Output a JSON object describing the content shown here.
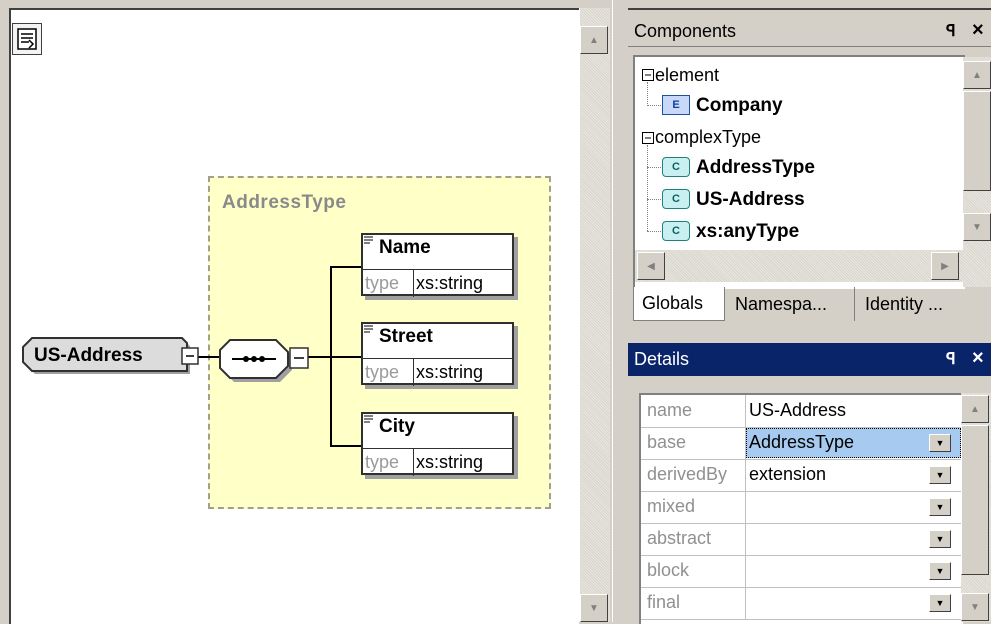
{
  "diagram": {
    "root_element": "US-Address",
    "complex_type_label": "AddressType",
    "compositor": "sequence",
    "children": [
      {
        "name": "Name",
        "type_label": "type",
        "type_value": "xs:string"
      },
      {
        "name": "Street",
        "type_label": "type",
        "type_value": "xs:string"
      },
      {
        "name": "City",
        "type_label": "type",
        "type_value": "xs:string"
      }
    ]
  },
  "components": {
    "title": "Components",
    "pin": "1",
    "close": "×",
    "tree": {
      "group1": "element",
      "group1_items": [
        {
          "icon": "E",
          "label": "Company"
        }
      ],
      "group2": "complexType",
      "group2_items": [
        {
          "icon": "C",
          "label": "AddressType"
        },
        {
          "icon": "C",
          "label": "US-Address"
        },
        {
          "icon": "C",
          "label": "xs:anyType"
        }
      ]
    },
    "tabs": [
      "Globals",
      "Namespa...",
      "Identity ..."
    ]
  },
  "details": {
    "title": "Details",
    "rows": [
      {
        "name": "name",
        "value": "US-Address",
        "dropdown": false
      },
      {
        "name": "base",
        "value": "AddressType",
        "dropdown": true,
        "selected": true
      },
      {
        "name": "derivedBy",
        "value": "extension",
        "dropdown": true
      },
      {
        "name": "mixed",
        "value": "",
        "dropdown": true
      },
      {
        "name": "abstract",
        "value": "",
        "dropdown": true
      },
      {
        "name": "block",
        "value": "",
        "dropdown": true
      },
      {
        "name": "final",
        "value": "",
        "dropdown": true
      }
    ]
  },
  "colors": {
    "type_box_fill": "#ffffc8",
    "selection_blue": "#a6caf0",
    "title_bar_active": "#0a246a"
  }
}
